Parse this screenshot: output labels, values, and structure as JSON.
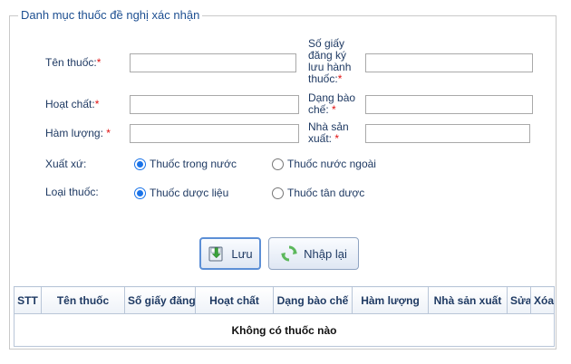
{
  "legend": "Danh mục thuốc đề nghị xác nhận",
  "form": {
    "ten_thuoc_label": "Tên thuốc:",
    "so_giay_label_lines": [
      "Số giấy",
      "đăng ký",
      "lưu hành",
      "thuốc:"
    ],
    "hoat_chat_label": "Hoạt chất:",
    "dang_bao_che_label_lines": [
      "Dạng bào",
      "chế: "
    ],
    "ham_luong_label": "Hàm lượng: ",
    "nha_san_xuat_label_lines": [
      "Nhà sản",
      "xuất: "
    ],
    "required_mark": "*",
    "ten_thuoc_value": "",
    "so_giay_value": "",
    "hoat_chat_value": "",
    "dang_bao_che_value": "",
    "ham_luong_value": "",
    "nha_san_xuat_value": ""
  },
  "xuat_xu": {
    "label": "Xuất xứ:",
    "options": [
      "Thuốc trong nước",
      "Thuốc nước ngoài"
    ],
    "selected": "Thuốc trong nước"
  },
  "loai_thuoc": {
    "label": "Loại thuốc:",
    "options": [
      "Thuốc dược liệu",
      "Thuốc tân dược"
    ],
    "selected": "Thuốc dược liệu"
  },
  "buttons": {
    "save_label": "Lưu",
    "reset_label": "Nhập lại"
  },
  "table": {
    "headers": [
      "STT",
      "Tên thuốc",
      "Số giấy đăng",
      "Hoạt chất",
      "Dạng bào chế",
      "Hàm lượng",
      "Nhà sản xuất",
      "Sửa",
      "Xóa"
    ],
    "empty_message": "Không có thuốc nào"
  },
  "colors": {
    "label_text": "#1f3a63",
    "legend_text": "#1d4f91",
    "required": "#e01010",
    "radio_accent": "#1a73e8"
  },
  "icons": {
    "save": "save-download-icon",
    "reset": "refresh-icon"
  }
}
